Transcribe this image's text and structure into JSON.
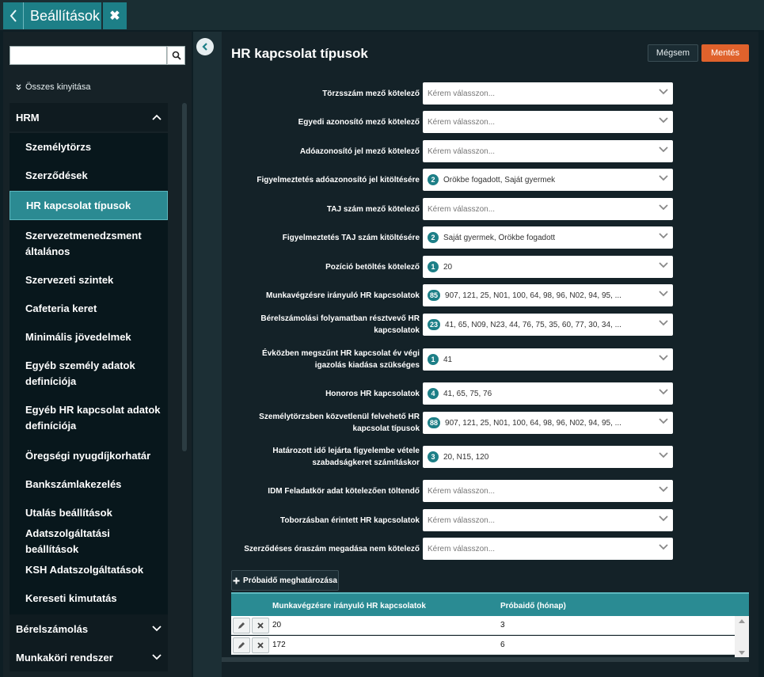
{
  "app": {
    "title": "Beállítások"
  },
  "sidebar": {
    "search": {
      "value": "",
      "placeholder": ""
    },
    "expand_all": "Összes kinyitása",
    "groups": [
      {
        "label": "HRM"
      },
      {
        "label": "Bérelszámolás"
      },
      {
        "label": "Munkaköri rendszer"
      }
    ],
    "items": [
      {
        "label": "Személytörzs"
      },
      {
        "label": "Szerződések"
      },
      {
        "label": "HR kapcsolat típusok"
      },
      {
        "label": "Szervezetmenedzsment általános"
      },
      {
        "label": "Szervezeti szintek"
      },
      {
        "label": "Cafeteria keret"
      },
      {
        "label": "Minimális jövedelmek"
      },
      {
        "label": "Egyéb személy adatok definíciója"
      },
      {
        "label": "Egyéb HR kapcsolat adatok definíciója"
      },
      {
        "label": "Öregségi nyugdíjkorhatár"
      },
      {
        "label": "Bankszámlakezelés"
      },
      {
        "label": "Utalás beállítások"
      },
      {
        "label": "Adatszolgáltatási beállítások"
      },
      {
        "label": "KSH Adatszolgáltatások"
      },
      {
        "label": "Kereseti kimutatás"
      }
    ]
  },
  "main": {
    "title": "HR kapcsolat típusok",
    "cancel": "Mégsem",
    "save": "Mentés",
    "fields": [
      {
        "label": "Törzsszám mező kötelező",
        "badge": "",
        "value": "Kérem válasszon..."
      },
      {
        "label": "Egyedi azonosító mező kötelező",
        "badge": "",
        "value": "Kérem válasszon..."
      },
      {
        "label": "Adóazonosító jel mező kötelező",
        "badge": "",
        "value": "Kérem válasszon..."
      },
      {
        "label": "Figyelmeztetés adóazonosító jel kitöltésére",
        "badge": "2",
        "value": "Örökbe fogadott, Saját gyermek"
      },
      {
        "label": "TAJ szám mező kötelező",
        "badge": "",
        "value": "Kérem válasszon..."
      },
      {
        "label": "Figyelmeztetés TAJ szám kitöltésére",
        "badge": "2",
        "value": "Saját gyermek, Örökbe fogadott"
      },
      {
        "label": "Pozíció betöltés kötelező",
        "badge": "1",
        "value": "20"
      },
      {
        "label": "Munkavégzésre irányuló HR kapcsolatok",
        "badge": "85",
        "value": "907, 121, 25, N01, 100, 64, 98, 96, N02, 94, 95, ..."
      },
      {
        "label": "Bérelszámolási folyamatban résztvevő HR kapcsolatok",
        "badge": "23",
        "value": "41, 65, N09, N23, 44, 76, 75, 35, 60, 77, 30, 34, ..."
      },
      {
        "label": "Évközben megszűnt HR kapcsolat év végi igazolás kiadása szükséges",
        "badge": "1",
        "value": "41"
      },
      {
        "label": "Honoros HR kapcsolatok",
        "badge": "4",
        "value": "41, 65, 75, 76"
      },
      {
        "label": "Személytörzsben közvetlenül felvehető HR kapcsolat típusok",
        "badge": "88",
        "value": "907, 121, 25, N01, 100, 64, 98, 96, N02, 94, 95, ..."
      },
      {
        "label": "Határozott idő lejárta figyelembe vétele szabadságkeret számításkor",
        "badge": "3",
        "value": "20, N15, 120"
      },
      {
        "label": "IDM Feladatkör adat kötelezően töltendő",
        "badge": "",
        "value": "Kérem válasszon..."
      },
      {
        "label": "Toborzásban érintett HR kapcsolatok",
        "badge": "",
        "value": "Kérem válasszon..."
      },
      {
        "label": "Szerződéses óraszám megadása nem kötelező",
        "badge": "",
        "value": "Kérem válasszon..."
      }
    ],
    "probaido_button": "Próbaidő meghatározása",
    "table": {
      "columns": [
        "Munkavégzésre irányuló HR kapcsolatok",
        "Próbaidő (hónap)"
      ],
      "rows": [
        [
          "20",
          "3"
        ],
        [
          "172",
          "6"
        ]
      ]
    }
  },
  "icons": {
    "back": "chevron-left-icon",
    "close": "close-icon",
    "search": "search-icon",
    "expand": "double-chevron-down-icon",
    "collapse": "chevron-left-circle-icon",
    "plus": "plus-icon",
    "edit": "pencil-icon",
    "delete": "x-icon"
  },
  "colors": {
    "accent": "#1d7f87",
    "save": "#e0622c",
    "background": "#142228"
  }
}
